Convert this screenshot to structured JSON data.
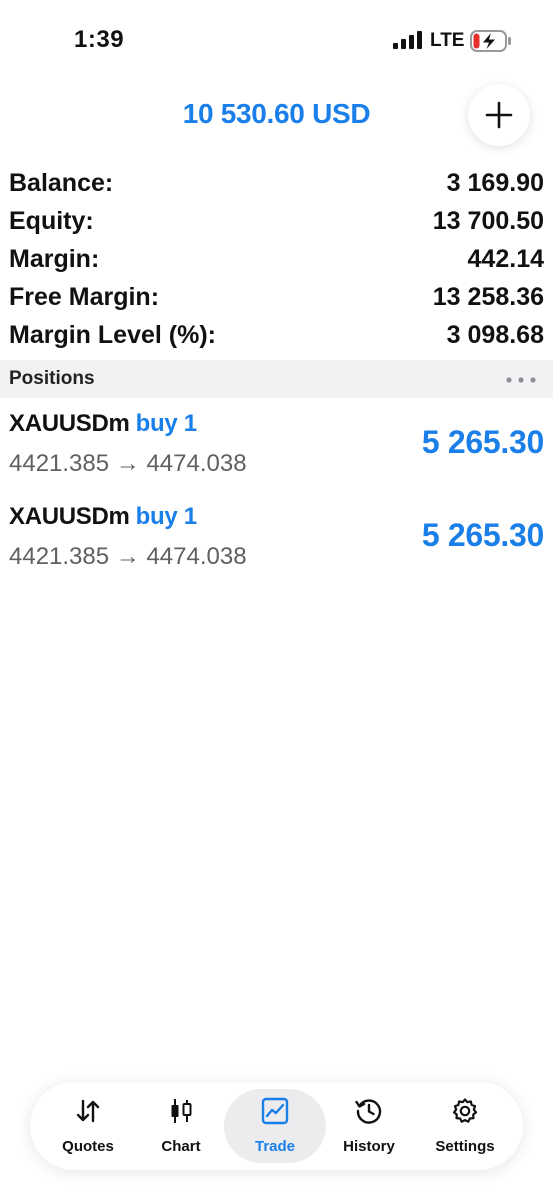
{
  "status_bar": {
    "time": "1:39",
    "network": "LTE",
    "signal_icon": "cellular-signal-icon",
    "battery_icon": "battery-charging-icon"
  },
  "header": {
    "title": "10 530.60 USD",
    "add_icon": "plus-icon"
  },
  "summary": [
    {
      "label": "Balance:",
      "value": "3 169.90"
    },
    {
      "label": "Equity:",
      "value": "13 700.50"
    },
    {
      "label": "Margin:",
      "value": "442.14"
    },
    {
      "label": "Free Margin:",
      "value": "13 258.36"
    },
    {
      "label": "Margin Level (%):",
      "value": "3 098.68"
    }
  ],
  "positions_section": {
    "title": "Positions",
    "more_icon": "more-horizontal-icon"
  },
  "positions": [
    {
      "symbol": "XAUUSDm",
      "side": "buy 1",
      "prices": "4421.385 → 4474.038",
      "profit": "5 265.30"
    },
    {
      "symbol": "XAUUSDm",
      "side": "buy 1",
      "prices": "4421.385 → 4474.038",
      "profit": "5 265.30"
    }
  ],
  "tab_bar": [
    {
      "label": "Quotes",
      "icon": "arrows-updown-icon",
      "active": false
    },
    {
      "label": "Chart",
      "icon": "candlestick-icon",
      "active": false
    },
    {
      "label": "Trade",
      "icon": "trade-chart-icon",
      "active": true
    },
    {
      "label": "History",
      "icon": "history-clock-icon",
      "active": false
    },
    {
      "label": "Settings",
      "icon": "gear-icon",
      "active": false
    }
  ],
  "colors": {
    "accent": "#1a7fe8",
    "text": "#111111",
    "secondary_text": "#606064",
    "section_bg": "#f2f2f4",
    "active_tab_bg": "#ececef"
  }
}
